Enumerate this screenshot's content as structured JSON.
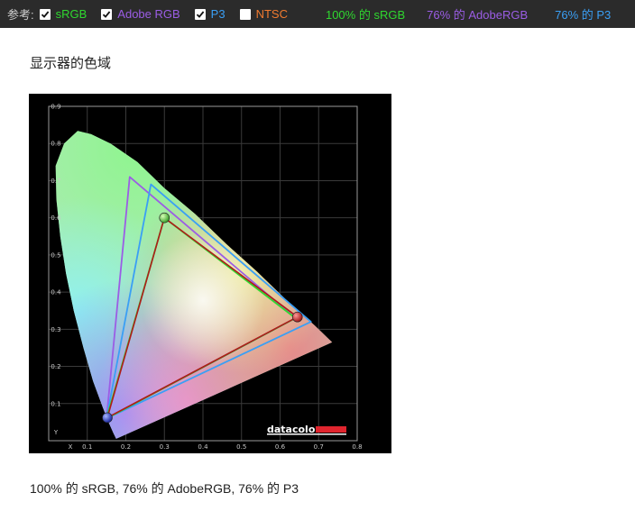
{
  "toolbar": {
    "reference_label": "参考:",
    "options": [
      {
        "label": "sRGB",
        "checked": true,
        "color": "#2fd82f"
      },
      {
        "label": "Adobe RGB",
        "checked": true,
        "color": "#9b5de5"
      },
      {
        "label": "P3",
        "checked": true,
        "color": "#3a9ff5"
      },
      {
        "label": "NTSC",
        "checked": false,
        "color": "#f07a2f"
      }
    ],
    "stats": [
      {
        "text": "100% 的 sRGB",
        "color": "#2fd82f"
      },
      {
        "text": "76% 的 AdobeRGB",
        "color": "#9b5de5"
      },
      {
        "text": "76% 的 P3",
        "color": "#3a9ff5"
      }
    ]
  },
  "page": {
    "title": "显示器的色域",
    "summary": [
      "100% 的 sRGB",
      "76% 的 AdobeRGB",
      "76% 的 P3"
    ],
    "summary_separator": ", "
  },
  "chart_data": {
    "type": "scatter",
    "xlim": [
      0,
      0.8
    ],
    "ylim": [
      0,
      0.9
    ],
    "x_tick_labels": [
      "X",
      "0.1",
      "0.2",
      "0.3",
      "0.4",
      "0.5",
      "0.6",
      "0.7",
      "0.8"
    ],
    "y_tick_labels": [
      "Y",
      "0.1",
      "0.2",
      "0.3",
      "0.4",
      "0.5",
      "0.6",
      "0.7",
      "0.8",
      "0.9"
    ],
    "grid": true,
    "brand": "datacolor",
    "spectral_locus": [
      [
        0.175,
        0.005
      ],
      [
        0.168,
        0.02
      ],
      [
        0.155,
        0.05
      ],
      [
        0.14,
        0.09
      ],
      [
        0.115,
        0.16
      ],
      [
        0.09,
        0.25
      ],
      [
        0.065,
        0.35
      ],
      [
        0.045,
        0.45
      ],
      [
        0.03,
        0.55
      ],
      [
        0.02,
        0.65
      ],
      [
        0.018,
        0.74
      ],
      [
        0.04,
        0.8
      ],
      [
        0.075,
        0.834
      ],
      [
        0.11,
        0.825
      ],
      [
        0.16,
        0.8
      ],
      [
        0.23,
        0.75
      ],
      [
        0.3,
        0.68
      ],
      [
        0.38,
        0.61
      ],
      [
        0.46,
        0.53
      ],
      [
        0.54,
        0.455
      ],
      [
        0.62,
        0.375
      ],
      [
        0.69,
        0.31
      ],
      [
        0.735,
        0.265
      ]
    ],
    "gamuts": [
      {
        "name": "Adobe RGB",
        "color": "#9b5de5",
        "points": [
          [
            0.64,
            0.33
          ],
          [
            0.21,
            0.71
          ],
          [
            0.15,
            0.06
          ]
        ]
      },
      {
        "name": "P3",
        "color": "#3a9ff5",
        "points": [
          [
            0.68,
            0.32
          ],
          [
            0.265,
            0.69
          ],
          [
            0.15,
            0.06
          ]
        ]
      },
      {
        "name": "sRGB",
        "color": "#2fd82f",
        "points": [
          [
            0.64,
            0.33
          ],
          [
            0.3,
            0.6
          ],
          [
            0.15,
            0.06
          ]
        ]
      },
      {
        "name": "Display",
        "color": "#b01a1a",
        "points": [
          [
            0.645,
            0.333
          ],
          [
            0.3,
            0.6
          ],
          [
            0.152,
            0.062
          ]
        ]
      }
    ],
    "primaries": [
      {
        "x": 0.645,
        "y": 0.333,
        "color": "#d21f1f"
      },
      {
        "x": 0.3,
        "y": 0.6,
        "color": "#4fd43f"
      },
      {
        "x": 0.152,
        "y": 0.062,
        "color": "#2a3fe0"
      }
    ]
  }
}
